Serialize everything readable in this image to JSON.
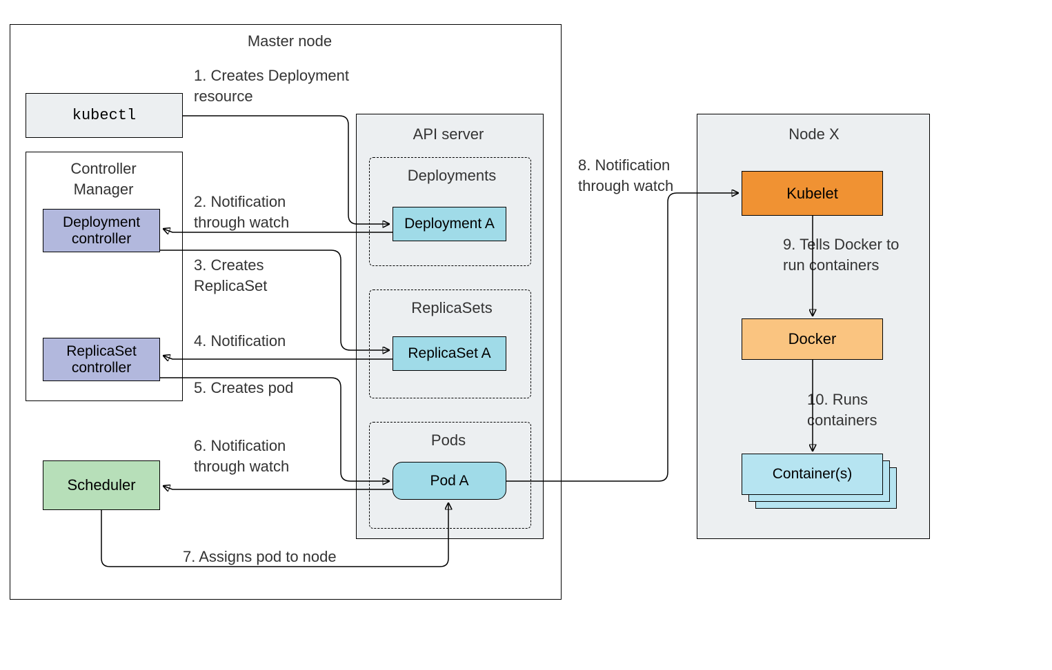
{
  "master": {
    "title": "Master node",
    "kubectl": "kubectl",
    "controller_manager": {
      "title": "Controller\nManager",
      "deployment_controller": "Deployment\ncontroller",
      "replicaset_controller": "ReplicaSet\ncontroller"
    },
    "scheduler": "Scheduler",
    "api_server": {
      "title": "API server",
      "deployments": {
        "title": "Deployments",
        "item": "Deployment A"
      },
      "replicasets": {
        "title": "ReplicaSets",
        "item": "ReplicaSet A"
      },
      "pods": {
        "title": "Pods",
        "item": "Pod A"
      }
    }
  },
  "node_x": {
    "title": "Node X",
    "kubelet": "Kubelet",
    "docker": "Docker",
    "containers": "Container(s)"
  },
  "steps": {
    "s1": "1. Creates Deployment\n    resource",
    "s2": "2. Notification\n    through watch",
    "s3": "3. Creates\n    ReplicaSet",
    "s4": "4. Notification",
    "s5": "5. Creates pod",
    "s6": "6. Notification\n    through watch",
    "s7": "7. Assigns pod to node",
    "s8": "8. Notification\n    through watch",
    "s9": "9. Tells Docker to\n    run containers",
    "s10": "10. Runs\n      containers"
  }
}
